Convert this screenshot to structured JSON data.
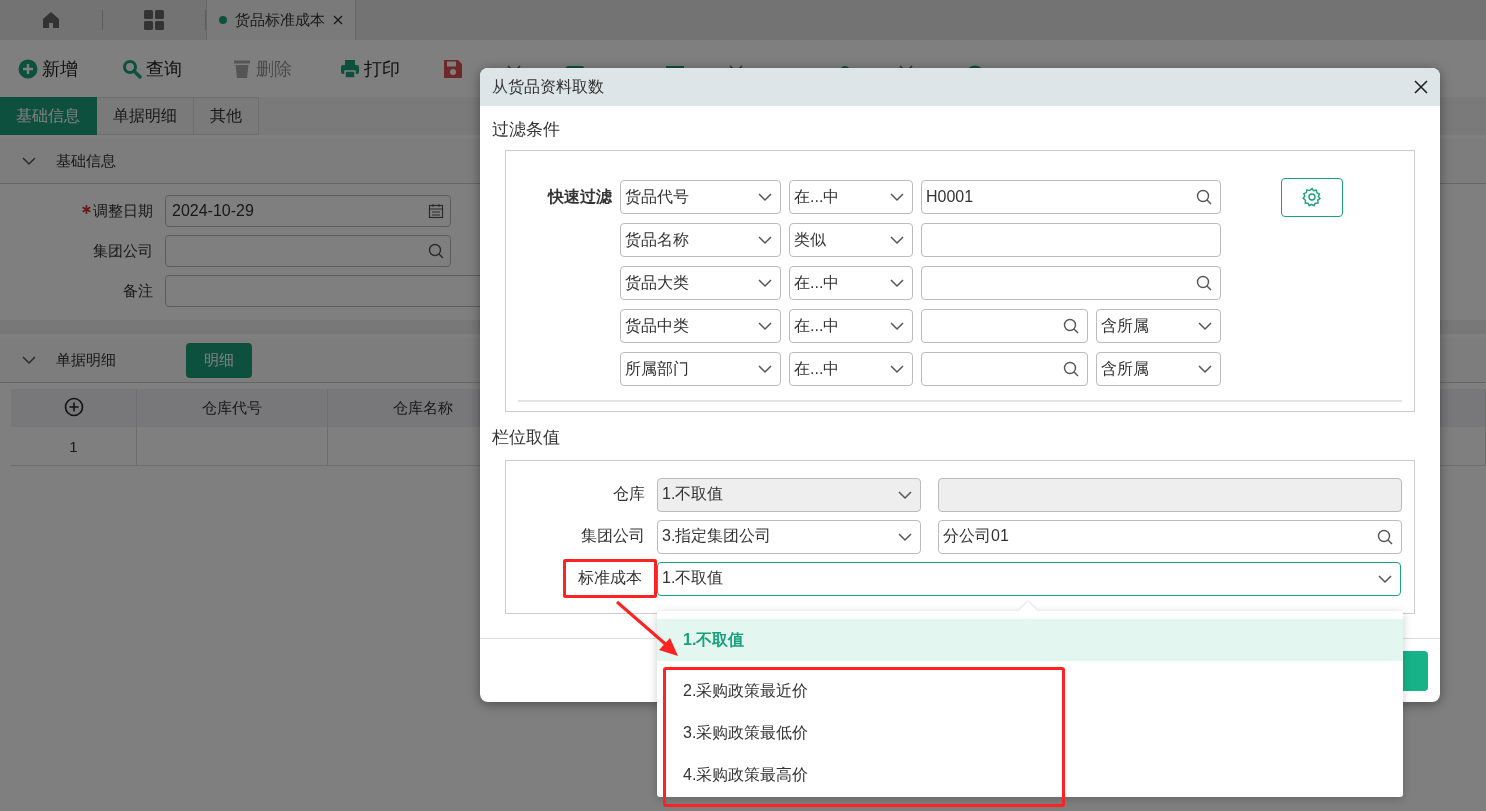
{
  "tab_bar": {
    "tabs": [
      {
        "label": "货品标准成本",
        "selected": true
      }
    ]
  },
  "toolbar": [
    {
      "label": "新增",
      "kind": "plus",
      "disabled": false,
      "has_menu": false
    },
    {
      "label": "查询",
      "kind": "search",
      "disabled": false,
      "has_menu": false
    },
    {
      "label": "删除",
      "kind": "trash",
      "disabled": true,
      "has_menu": false
    },
    {
      "label": "打印",
      "kind": "printer",
      "disabled": false,
      "has_menu": false
    },
    {
      "kind": "floppy",
      "disabled": false,
      "has_menu": true
    },
    {
      "kind": "upload"
    },
    {
      "kind": "window",
      "disabled": false,
      "has_menu": true
    },
    {
      "kind": "pin",
      "disabled": false,
      "has_menu": true
    },
    {
      "kind": "close"
    }
  ],
  "page_tabs": [
    {
      "label": "基础信息",
      "selected": true
    },
    {
      "label": "单据明细",
      "selected": false
    },
    {
      "label": "其他",
      "selected": false
    }
  ],
  "basic_section": {
    "title": "基础信息",
    "expanded": true,
    "fields": [
      {
        "label": "调整日期",
        "required": true,
        "value": "2024-10-29",
        "kind": "date"
      },
      {
        "label": "集团公司",
        "required": false,
        "kind": "search"
      },
      {
        "label": "备注",
        "required": false,
        "kind": "text"
      }
    ]
  },
  "detail_section": {
    "title": "单据明细",
    "expanded": true,
    "button": "明细",
    "table": {
      "columns": [
        "仓库代号",
        "仓库名称"
      ],
      "rows": [
        {
          "index": "1"
        }
      ]
    }
  },
  "dialog": {
    "title": "从货品资料取数",
    "filter_title": "过滤条件",
    "quick_filter_label": "快速过滤",
    "filters": [
      {
        "field": "货品代号",
        "operator": "在...中",
        "value": "H0001",
        "kind": "search"
      },
      {
        "field": "货品名称",
        "operator": "类似",
        "kind": "text"
      },
      {
        "field": "货品大类",
        "operator": "在...中",
        "kind": "search"
      },
      {
        "field": "货品中类",
        "operator": "在...中",
        "kind": "search",
        "scope": "含所属"
      },
      {
        "field": "所属部门",
        "operator": "在...中",
        "kind": "search",
        "scope": "含所属"
      }
    ],
    "column_title": "栏位取值",
    "columns": [
      {
        "label": "仓库",
        "mode": "1.不取值",
        "kind": "text",
        "disabled": true,
        "focused": false,
        "highlighted": false
      },
      {
        "label": "集团公司",
        "mode": "3.指定集团公司",
        "value": "分公司01",
        "kind": "search",
        "disabled": false,
        "focused": false,
        "highlighted": false
      },
      {
        "label": "标准成本",
        "mode": "1.不取值",
        "kind": "wide",
        "disabled": false,
        "focused": true,
        "highlighted": true
      }
    ]
  },
  "dropdown": {
    "options": [
      {
        "label": "1.不取值",
        "selected": true,
        "highlighted": false
      },
      {
        "label": "2.采购政策最近价",
        "selected": false,
        "highlighted": true
      },
      {
        "label": "3.采购政策最低价",
        "selected": false,
        "highlighted": true
      },
      {
        "label": "4.采购政策最高价",
        "selected": false,
        "highlighted": true
      }
    ]
  },
  "annotation_arrow": true
}
